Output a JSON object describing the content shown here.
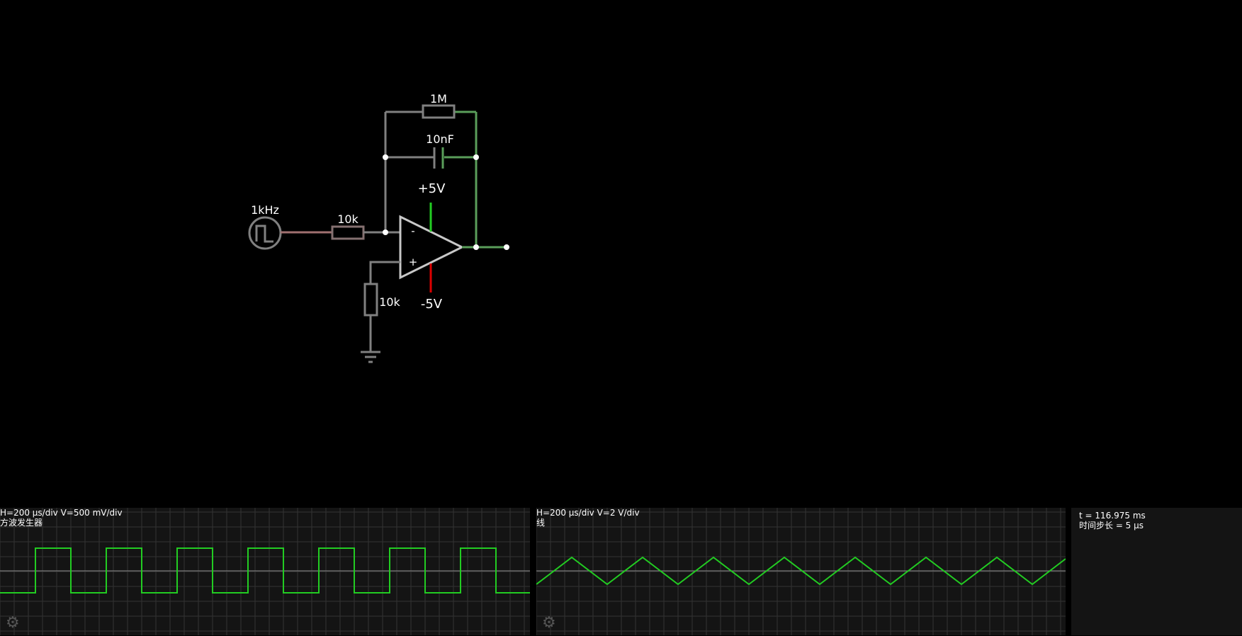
{
  "circuit": {
    "source_label": "1kHz",
    "r_in_label": "10k",
    "r_fb_label": "1M",
    "c_fb_label": "10nF",
    "vpos_label": "+5V",
    "vneg_label": "-5V",
    "r_gnd_label": "10k",
    "opamp_minus": "-",
    "opamp_plus": "+"
  },
  "scope1": {
    "scale": "H=200 μs/div V=500 mV/div",
    "name": "方波发生器",
    "trace_color": "#22cc22",
    "waveform": "square"
  },
  "scope2": {
    "scale": "H=200 μs/div V=2 V/div",
    "name": "线",
    "trace_color": "#22cc22",
    "waveform": "triangle"
  },
  "sim_info": {
    "time": "t = 116.975 ms",
    "timestep": "时间步长 = 5 μs"
  },
  "icons": {
    "settings": "gear-icon"
  }
}
